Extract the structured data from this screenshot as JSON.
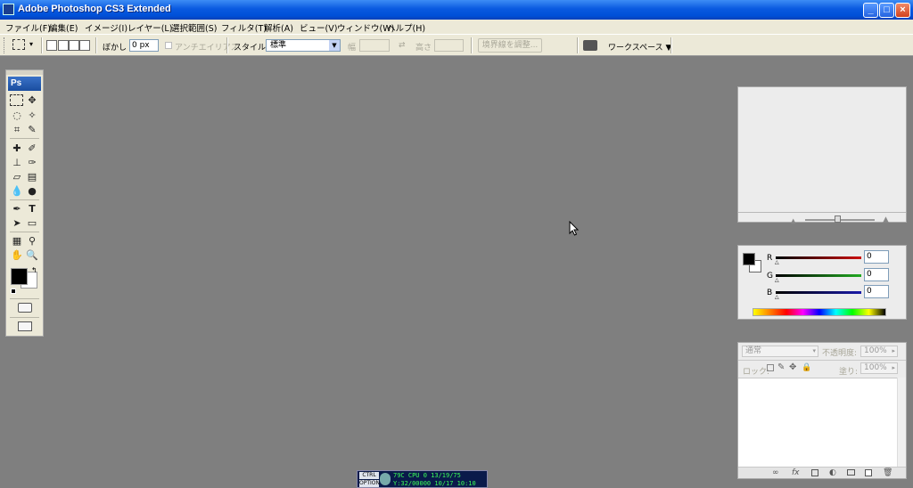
{
  "window": {
    "title": "Adobe Photoshop CS3 Extended"
  },
  "menu": [
    "ファイル(F)",
    "編集(E)",
    "イメージ(I)",
    "レイヤー(L)",
    "選択範囲(S)",
    "フィルタ(T)",
    "解析(A)",
    "ビュー(V)",
    "ウィンドウ(W)",
    "ヘルプ(H)"
  ],
  "options": {
    "feather_label": "ぼかし :",
    "feather_value": "0 px",
    "antialias_label": "アンチエイリアス",
    "style_label": "スタイル :",
    "style_value": "標準",
    "width_label": "幅",
    "height_label": "高さ",
    "refine_edge_label": "境界線を調整...",
    "workspace_label": "ワークスペース ▼"
  },
  "tools": {
    "ps_label": "Ps"
  },
  "color_panel": {
    "r_label": "R",
    "g_label": "G",
    "b_label": "B",
    "r_value": "0",
    "g_value": "0",
    "b_value": "0",
    "colors": {
      "r": "#cc1010",
      "g": "#22aa22",
      "b": "#1a1aa8"
    }
  },
  "layers_panel": {
    "blend_mode": "通常",
    "opacity_label": "不透明度:",
    "opacity_value": "100%",
    "lock_label": "ロック:",
    "fill_label": "塗り:",
    "fill_value": "100%"
  },
  "tray": {
    "key1": "CTRL",
    "key2": "OPTION",
    "line1": "79C  CPU  0 13/19/75",
    "line2": "Y:32/00000  10/17  10:10"
  }
}
